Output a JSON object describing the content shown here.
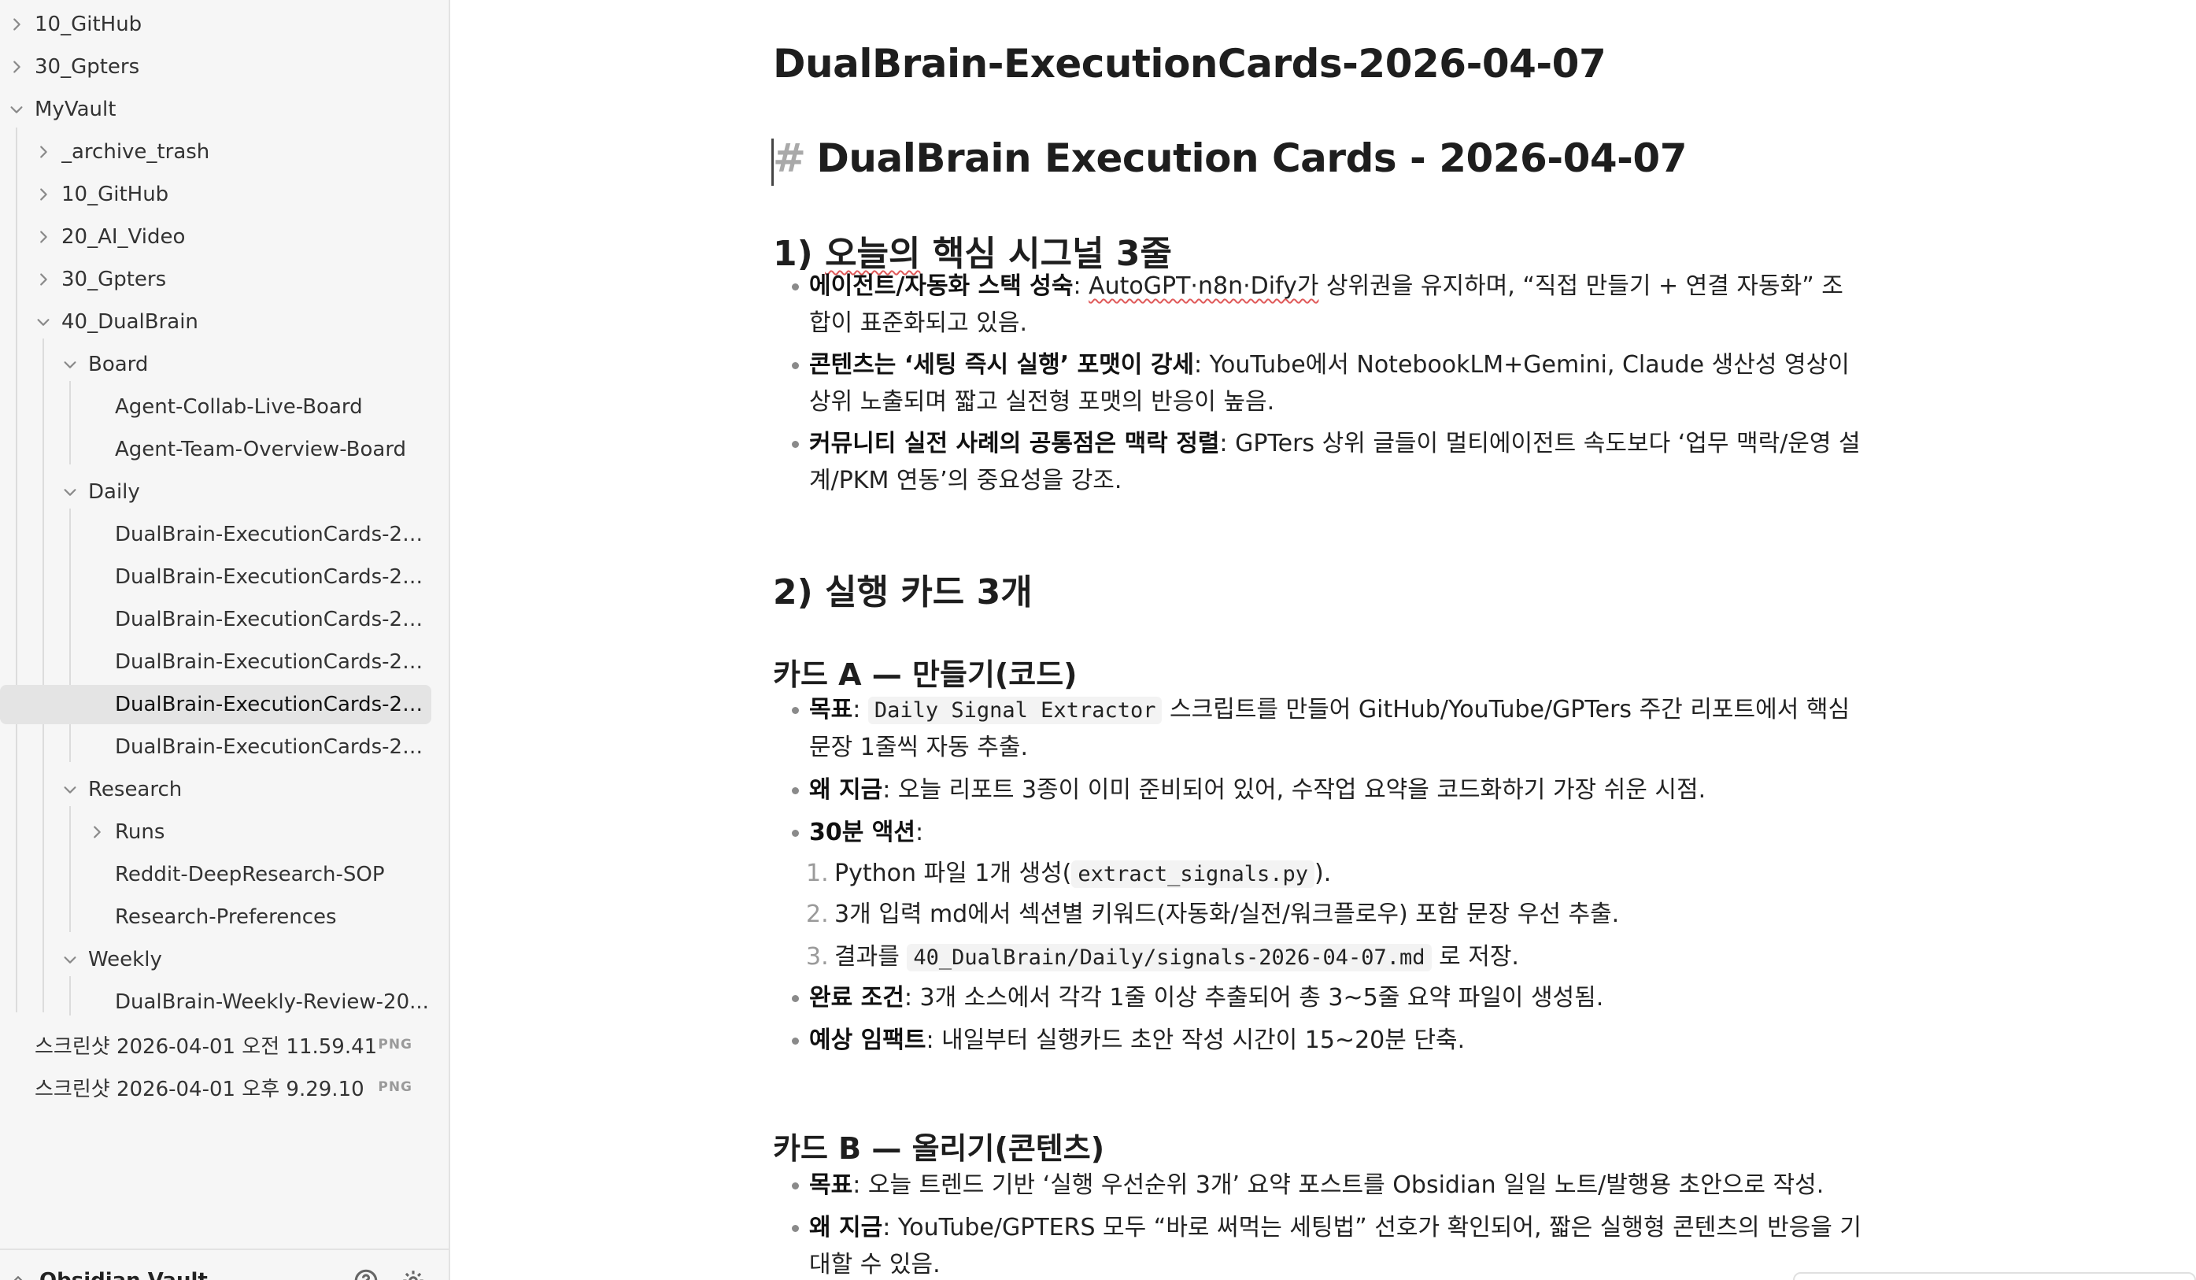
{
  "sidebar": {
    "rows": [
      {
        "label": "10_GitHub",
        "chev": "right"
      },
      {
        "label": "30_Gpters",
        "chev": "right"
      },
      {
        "label": "MyVault",
        "chev": "down"
      },
      {
        "label": "_archive_trash",
        "chev": "right"
      },
      {
        "label": "10_GitHub",
        "chev": "right"
      },
      {
        "label": "20_AI_Video",
        "chev": "right"
      },
      {
        "label": "30_Gpters",
        "chev": "right"
      },
      {
        "label": "40_DualBrain",
        "chev": "down"
      },
      {
        "label": "Board",
        "chev": "down"
      },
      {
        "label": "Agent-Collab-Live-Board"
      },
      {
        "label": "Agent-Team-Overview-Board"
      },
      {
        "label": "Daily",
        "chev": "down"
      },
      {
        "label": "DualBrain-ExecutionCards-20..."
      },
      {
        "label": "DualBrain-ExecutionCards-20..."
      },
      {
        "label": "DualBrain-ExecutionCards-20..."
      },
      {
        "label": "DualBrain-ExecutionCards-20..."
      },
      {
        "label": "DualBrain-ExecutionCards-20...",
        "active": true
      },
      {
        "label": "DualBrain-ExecutionCards-20..."
      },
      {
        "label": "Research",
        "chev": "down"
      },
      {
        "label": "Runs",
        "chev": "right"
      },
      {
        "label": "Reddit-DeepResearch-SOP"
      },
      {
        "label": "Research-Preferences"
      },
      {
        "label": "Weekly",
        "chev": "down"
      },
      {
        "label": "DualBrain-Weekly-Review-20..."
      },
      {
        "label": "스크린샷 2026-04-01 오전 11.59.41",
        "badge": "PNG"
      },
      {
        "label": "스크린샷 2026-04-01 오후 9.29.10",
        "badge": "PNG"
      }
    ],
    "vault_name": "Obsidian Vault"
  },
  "note": {
    "inline_title": "DualBrain-ExecutionCards-2026-04-07",
    "h1_hash": "#",
    "h1": "DualBrain Execution Cards - 2026-04-07",
    "s1": {
      "heading_num": "1)",
      "heading_word": "오늘의",
      "heading_rest": "핵심 시그널 3줄",
      "items": [
        {
          "bold": "에이전트/자동화 스택 성숙",
          "pre": ": ",
          "link": "AutoGPT·n8n·Dify가",
          "text": " 상위권을 유지하며, “직접 만들기 + 연결 자동화” 조합이 표준화되고 있음."
        },
        {
          "bold": "콘텐츠는 ‘세팅 즉시 실행’ 포맷이 강세",
          "text": ": YouTube에서 NotebookLM+Gemini, Claude 생산성 영상이 상위 노출되며 짧고 실전형 포맷의 반응이 높음."
        },
        {
          "bold": "커뮤니티 실전 사례의 공통점은 맥락 정렬",
          "text": ": GPTers 상위 글들이 멀티에이전트 속도보다 ‘업무 맥락/운영 설계/PKM 연동’의 중요성을 강조."
        }
      ]
    },
    "s2_heading": "2) 실행 카드 3개",
    "cardA": {
      "heading": "카드 A — 만들기(코드)",
      "goal_label": "목표",
      "goal_pre": ": ",
      "goal_code": "Daily Signal Extractor",
      "goal_text": " 스크립트를 만들어 GitHub/YouTube/GPTers 주간 리포트에서 핵심 문장 1줄씩 자동 추출.",
      "why_label": "왜 지금",
      "why_text": ": 오늘 리포트 3종이 이미 준비되어 있어, 수작업 요약을 코드화하기 가장 쉬운 시점.",
      "action_label": "30분 액션",
      "action_colon": ":",
      "steps": [
        {
          "num": "1.",
          "pre": "Python 파일 1개 생성(",
          "code": "extract_signals.py",
          "post": ")."
        },
        {
          "num": "2.",
          "pre": "3개 입력 md에서 섹션별 키워드(자동화/실전/워크플로우) 포함 문장 우선 추출.",
          "code": "",
          "post": ""
        },
        {
          "num": "3.",
          "pre": "결과를 ",
          "code": "40_DualBrain/Daily/signals-2026-04-07.md",
          "post": " 로 저장."
        }
      ],
      "done_label": "완료 조건",
      "done_text": ": 3개 소스에서 각각 1줄 이상 추출되어 총 3~5줄 요약 파일이 생성됨.",
      "impact_label": "예상 임팩트",
      "impact_text": ": 내일부터 실행카드 초안 작성 시간이 15~20분 단축."
    },
    "cardB": {
      "heading": "카드 B — 올리기(콘텐츠)",
      "goal_label": "목표",
      "goal_text": ": 오늘 트렌드 기반 ‘실행 우선순위 3개’ 요약 포스트를 Obsidian 일일 노트/발행용 초안으로 작성.",
      "why_label": "왜 지금",
      "why_text": ": YouTube/GPTERS 모두 “바로 써먹는 세팅법” 선호가 확인되어, 짧은 실행형 콘텐츠의 반응을 기대할 수 있음."
    }
  }
}
